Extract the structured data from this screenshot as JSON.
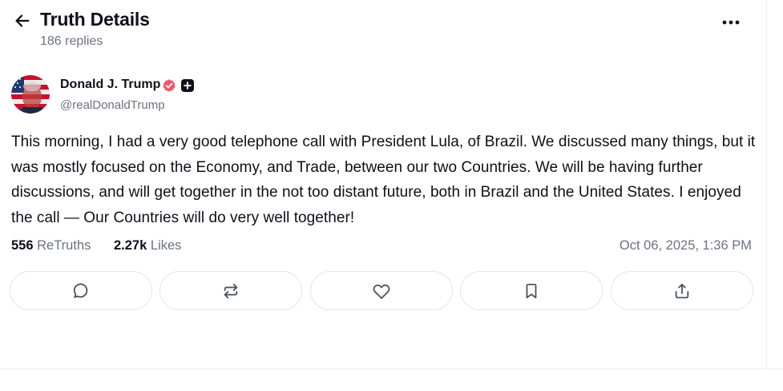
{
  "header": {
    "title": "Truth Details",
    "subtitle": "186 replies"
  },
  "author": {
    "name": "Donald J. Trump",
    "handle": "@realDonaldTrump"
  },
  "post": {
    "text": "This morning, I had a very good telephone call with President Lula, of Brazil. We discussed many things, but it was mostly focused on the Economy, and Trade, between our two Countries. We will be having further discussions, and will get together in the not too distant future, both in Brazil and the United States. I enjoyed the call — Our Countries will do very well together!"
  },
  "stats": {
    "retruths_count": "556",
    "retruths_label": "ReTruths",
    "likes_count": "2.27k",
    "likes_label": "Likes",
    "timestamp": "Oct 06, 2025, 1:36 PM"
  },
  "actions": {
    "reply_icon": "reply-icon",
    "retruth_icon": "retruth-icon",
    "like_icon": "heart-icon",
    "bookmark_icon": "bookmark-icon",
    "share_icon": "share-icon"
  },
  "colors": {
    "text": "#0f0f1a",
    "muted": "#6b7280",
    "verified": "#f0566e",
    "border": "#e3e6ea"
  }
}
